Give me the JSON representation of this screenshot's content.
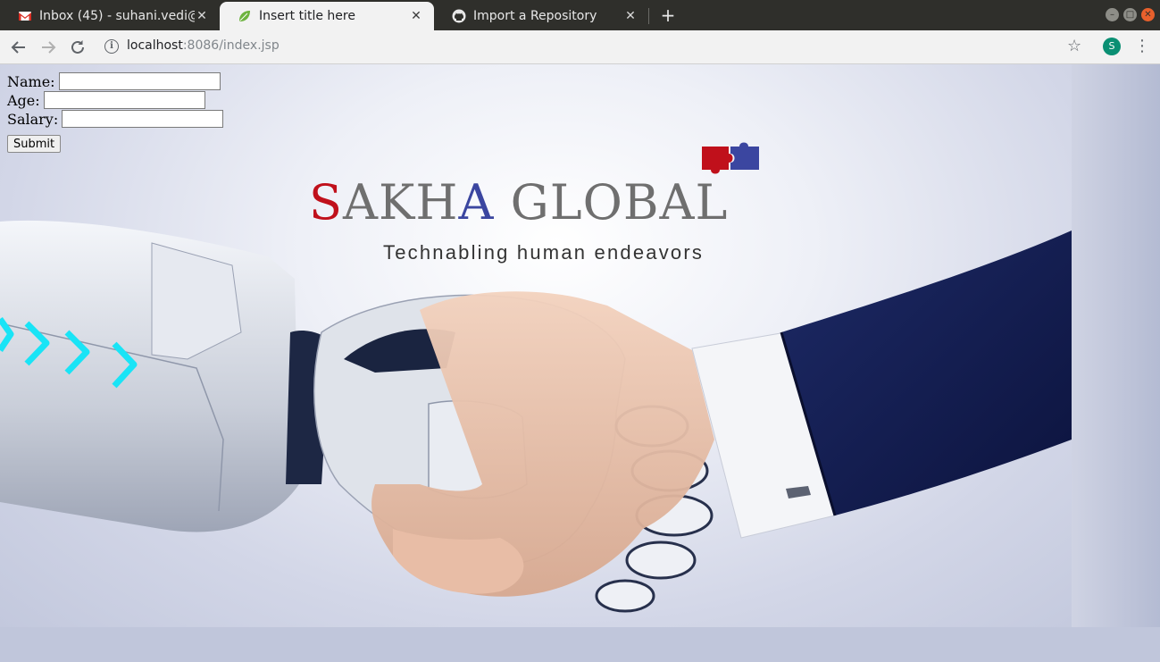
{
  "tabs": [
    {
      "title": "Inbox (45) - suhani.vedi@",
      "favicon": "gmail-icon",
      "active": false
    },
    {
      "title": "Insert title here",
      "favicon": "leaf-icon",
      "active": true
    },
    {
      "title": "Import a Repository",
      "favicon": "github-icon",
      "active": false
    }
  ],
  "toolbar": {
    "url_host": "localhost",
    "url_rest": ":8086/index.jsp",
    "profile_initial": "S"
  },
  "form": {
    "name_label": "Name:",
    "name_value": "",
    "age_label": "Age:",
    "age_value": "",
    "salary_label": "Salary:",
    "salary_value": "",
    "submit_label": "Submit"
  },
  "logo": {
    "title_s": "S",
    "title_akh": "AKH",
    "title_a": "A",
    "title_global": " GLOBAL",
    "tagline": "Technabling human endeavors"
  },
  "colors": {
    "logo_red": "#c0101b",
    "logo_blue": "#3b46a0",
    "logo_gray": "#6f6f6f",
    "profile_green": "#0a8f73"
  }
}
